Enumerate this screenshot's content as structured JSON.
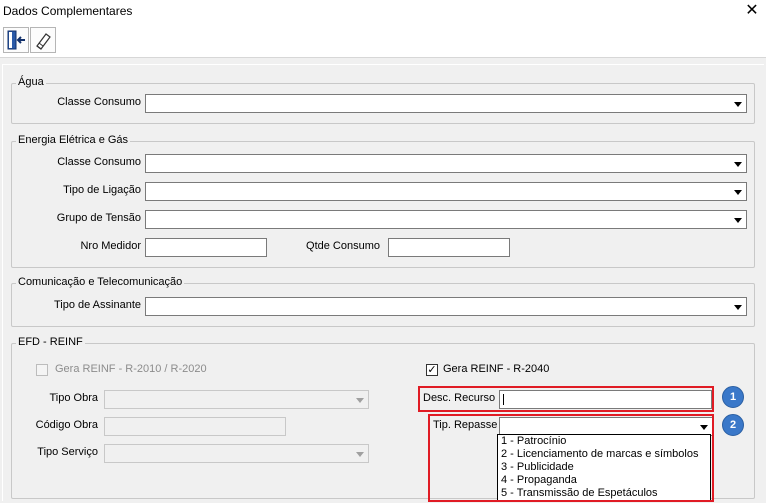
{
  "window": {
    "title": "Dados Complementares",
    "close_glyph": "✕"
  },
  "toolbar": {
    "exit_icon": "exit-door-icon",
    "eraser_icon": "eraser-icon"
  },
  "agua": {
    "legend": "Água",
    "classe_consumo_label": "Classe Consumo",
    "classe_consumo_value": ""
  },
  "energia": {
    "legend": "Energia Elétrica e Gás",
    "classe_consumo_label": "Classe Consumo",
    "tipo_ligacao_label": "Tipo de Ligação",
    "grupo_tensao_label": "Grupo de Tensão",
    "nro_medidor_label": "Nro Medidor",
    "qtde_consumo_label": "Qtde Consumo"
  },
  "comunicacao": {
    "legend": "Comunicação e Telecomunicação",
    "tipo_assinante_label": "Tipo de Assinante"
  },
  "efd": {
    "legend": "EFD - REINF",
    "gera_2010_label": "Gera REINF - R-2010 / R-2020",
    "gera_2010_checked": false,
    "gera_2040_label": "Gera REINF - R-2040",
    "gera_2040_checked": true,
    "check_glyph": "✓",
    "tipo_obra_label": "Tipo Obra",
    "codigo_obra_label": "Código Obra",
    "tipo_servico_label": "Tipo Serviço",
    "desc_recurso_label": "Desc. Recurso",
    "tip_repasse_label": "Tip. Repasse",
    "repasse_options": [
      "1 - Patrocínio",
      "2 - Licenciamento de marcas e símbolos",
      "3 - Publicidade",
      "4 - Propaganda",
      "5 - Transmissão de Espetáculos"
    ]
  },
  "annotations": {
    "badge1": "1",
    "badge2": "2",
    "highlight_color": "#e01b24",
    "badge_color": "#3a78c9"
  }
}
